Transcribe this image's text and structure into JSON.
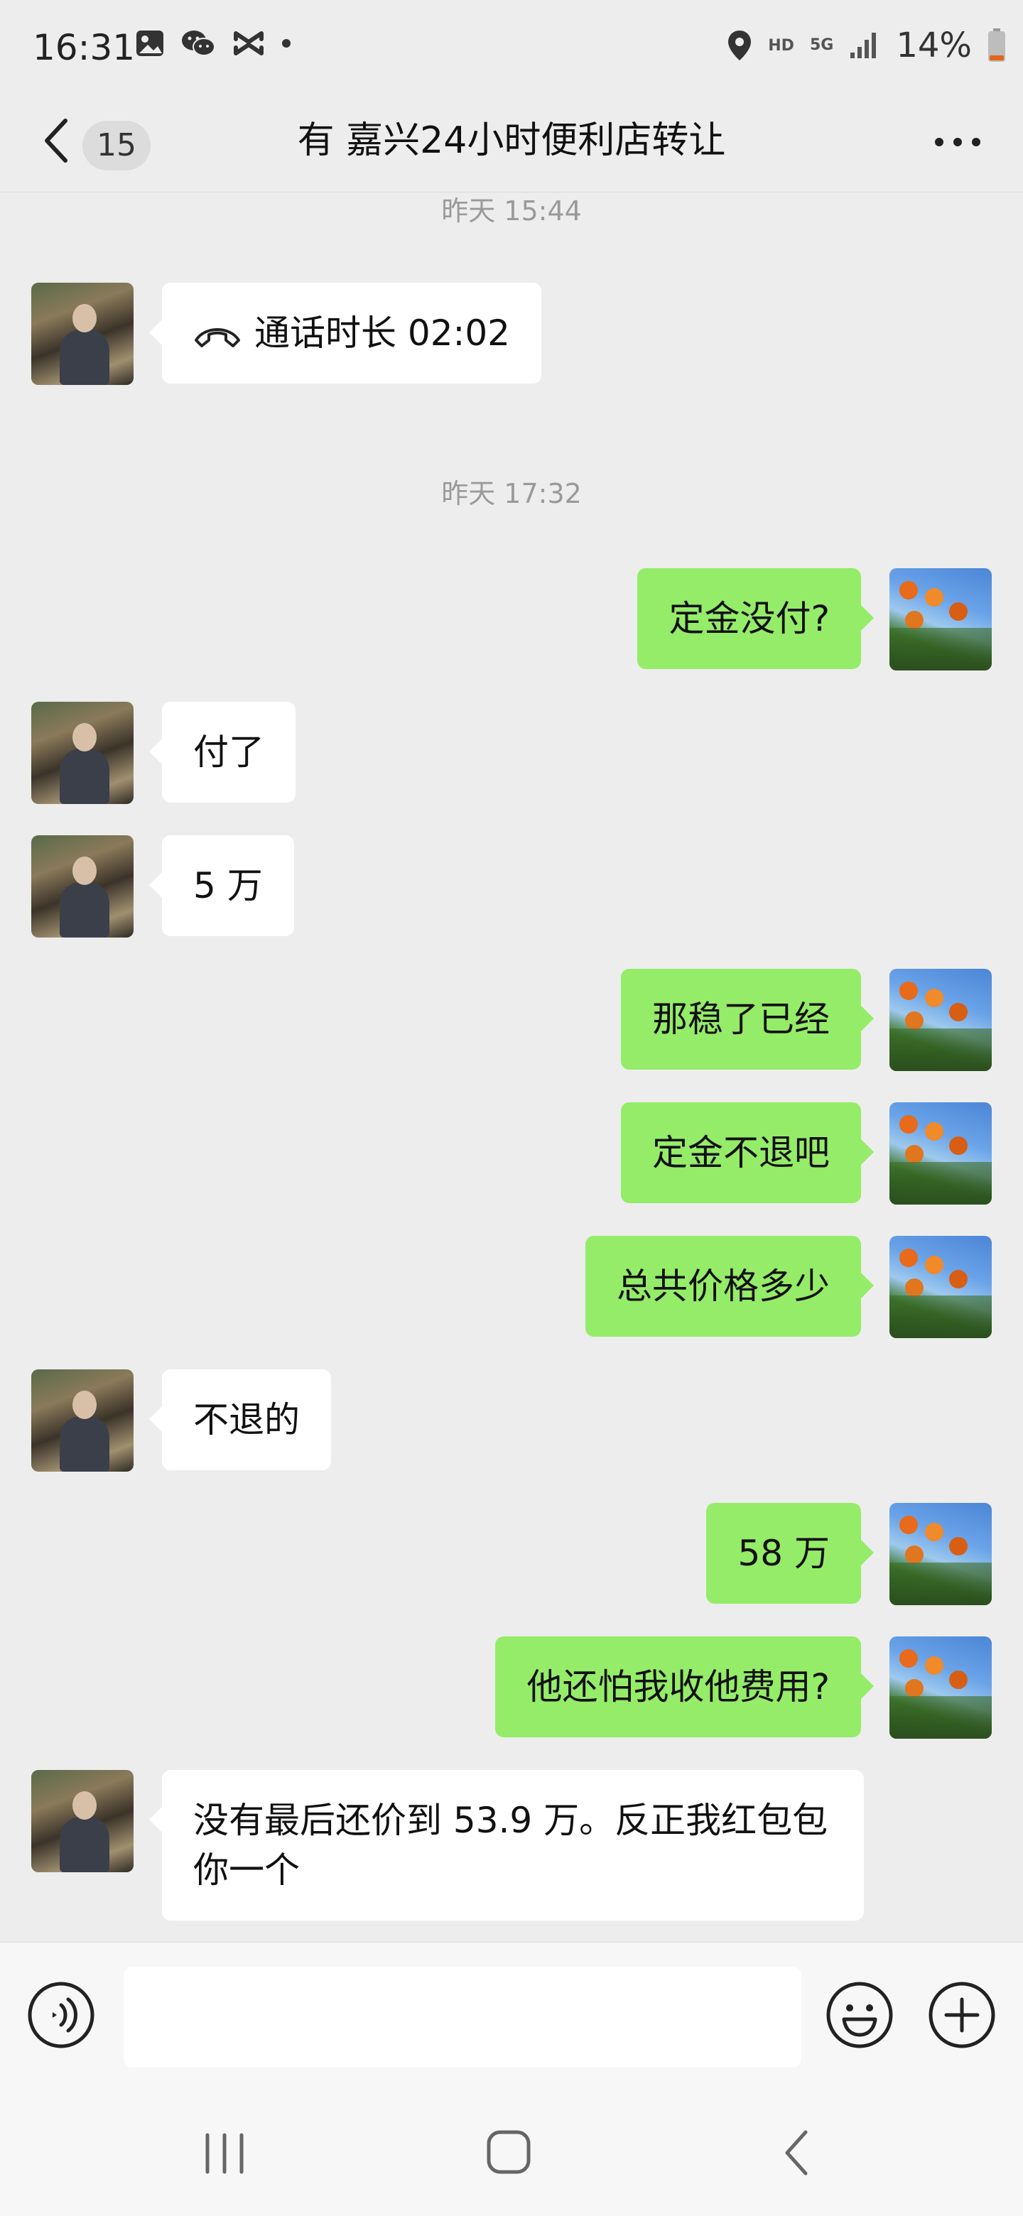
{
  "status_bar": {
    "time": "16:31",
    "hd_label": "HD",
    "network_label": "5G",
    "battery": "14%"
  },
  "header": {
    "unread_count": "15",
    "title": "有 嘉兴24小时便利店转让"
  },
  "messages": [
    {
      "type": "time",
      "text": "昨天 15:44"
    },
    {
      "type": "call",
      "from": "other",
      "text": "通话时长 02:02"
    },
    {
      "type": "time",
      "text": "昨天 17:32"
    },
    {
      "type": "text",
      "from": "me",
      "text": "定金没付?"
    },
    {
      "type": "text",
      "from": "other",
      "text": "付了"
    },
    {
      "type": "text",
      "from": "other",
      "text": "5 万"
    },
    {
      "type": "text",
      "from": "me",
      "text": "那稳了已经"
    },
    {
      "type": "text",
      "from": "me",
      "text": "定金不退吧"
    },
    {
      "type": "text",
      "from": "me",
      "text": "总共价格多少"
    },
    {
      "type": "text",
      "from": "other",
      "text": "不退的"
    },
    {
      "type": "text",
      "from": "me",
      "text": "58 万"
    },
    {
      "type": "text",
      "from": "me",
      "text": "他还怕我收他费用?"
    },
    {
      "type": "text",
      "from": "other",
      "text": "没有最后还价到 53.9 万。反正我红包包你一个"
    }
  ],
  "input": {
    "value": ""
  },
  "colors": {
    "background": "#ededed",
    "my_bubble": "#95ec69",
    "other_bubble": "#ffffff"
  }
}
